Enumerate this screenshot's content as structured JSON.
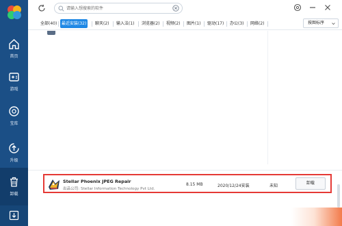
{
  "search": {
    "placeholder": "请输入想搜索的软件"
  },
  "sidebar": {
    "items": [
      {
        "label": "首页",
        "icon": "home-icon"
      },
      {
        "label": "游戏",
        "icon": "gamepad-icon"
      },
      {
        "label": "宝库",
        "icon": "treasure-icon"
      },
      {
        "label": "升级",
        "icon": "upgrade-icon"
      },
      {
        "label": "卸载",
        "icon": "trash-icon"
      }
    ],
    "active": "卸载"
  },
  "tabs": [
    {
      "label": "全部(40)"
    },
    {
      "label": "最近安装(32)",
      "active": true
    },
    {
      "label": "聊天(2)"
    },
    {
      "label": "输入法(1)"
    },
    {
      "label": "浏览器(2)"
    },
    {
      "label": "视频(2)"
    },
    {
      "label": "图片(1)"
    },
    {
      "label": "驱动(17)"
    },
    {
      "label": "办公(3)"
    },
    {
      "label": "网络(2)"
    }
  ],
  "sort": {
    "label": "按图标序"
  },
  "app": {
    "name": "Stellar Phoenix JPEG Repair",
    "publisher": "出品公司: Stellar Information Technology Pvt Ltd.",
    "size": "8.15 MB",
    "install_date": "2020/12/24安装",
    "usage": "未知",
    "uninstall_label": "卸载"
  },
  "colors": {
    "sidebar": "#1b4f86",
    "accent": "#1e88e5",
    "highlight": "#e53935"
  }
}
